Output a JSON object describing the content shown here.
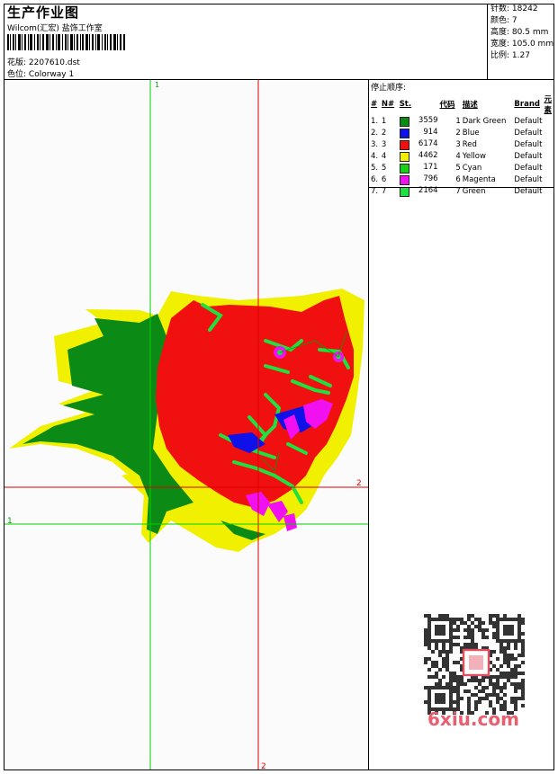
{
  "header": {
    "title": "生产作业图",
    "company": "Wilcom(汇宏) 盐饰工作室",
    "design_label": "花版:",
    "design_file": "2207610.dst",
    "colorway_label": "色位:",
    "colorway": "Colorway 1"
  },
  "stats": {
    "stitches_label": "针数:",
    "stitches": "18242",
    "colors_label": "颜色:",
    "colors": "7",
    "height_label": "高度:",
    "height": "80.5 mm",
    "width_label": "宽度:",
    "width": "105.0 mm",
    "scale_label": "比例:",
    "scale": "1.27"
  },
  "stop_sequence": {
    "title": "停止顺序:",
    "headers": [
      "#",
      "N#",
      "St.",
      "代码",
      "描述",
      "Brand",
      "元素"
    ],
    "rows": [
      {
        "num": "1.",
        "n": "1",
        "color": "#0b8a16",
        "stitches": "3559",
        "code": "1",
        "desc": "Dark Green",
        "brand": "Default"
      },
      {
        "num": "2.",
        "n": "2",
        "color": "#1010e8",
        "stitches": "914",
        "code": "2",
        "desc": "Blue",
        "brand": "Default"
      },
      {
        "num": "3.",
        "n": "3",
        "color": "#f01010",
        "stitches": "6174",
        "code": "3",
        "desc": "Red",
        "brand": "Default"
      },
      {
        "num": "4.",
        "n": "4",
        "color": "#f0f000",
        "stitches": "4462",
        "code": "4",
        "desc": "Yellow",
        "brand": "Default"
      },
      {
        "num": "5.",
        "n": "5",
        "color": "#18d018",
        "stitches": "171",
        "code": "5",
        "desc": "Cyan",
        "brand": "Default"
      },
      {
        "num": "6.",
        "n": "6",
        "color": "#f010f0",
        "stitches": "796",
        "code": "6",
        "desc": "Magenta",
        "brand": "Default"
      },
      {
        "num": "7.",
        "n": "7",
        "color": "#20e040",
        "stitches": "2164",
        "code": "7",
        "desc": "Green",
        "brand": "Default"
      }
    ]
  },
  "guides": {
    "v1_label": "1",
    "v2_label": "2",
    "h1_label": "1",
    "h2_label": "2",
    "green": "#00d000",
    "red": "#e00000"
  },
  "watermark": "6xiu.com"
}
